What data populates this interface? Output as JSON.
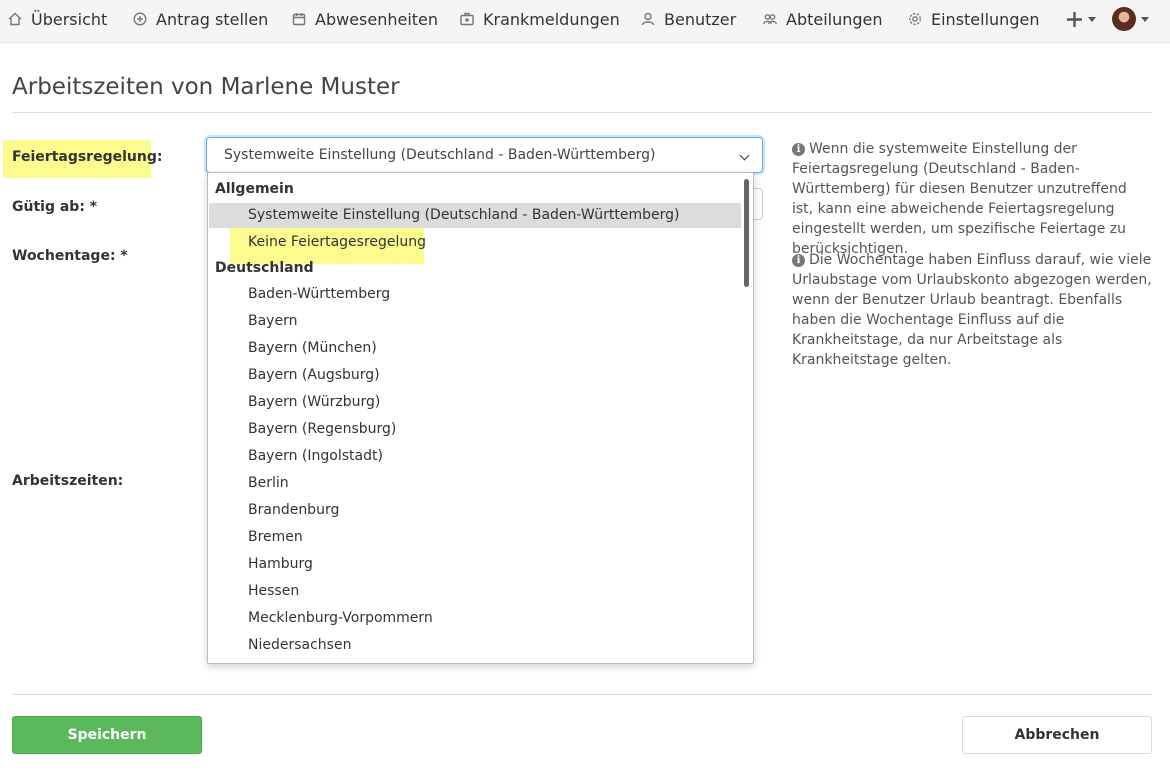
{
  "nav": {
    "overview": "Übersicht",
    "apply": "Antrag stellen",
    "absences": "Abwesenheiten",
    "sick_notes": "Krankmeldungen",
    "users": "Benutzer",
    "departments": "Abteilungen",
    "settings": "Einstellungen"
  },
  "page": {
    "title": "Arbeitszeiten von Marlene Muster"
  },
  "form": {
    "holiday_label": "Feiertagsregelung:",
    "valid_from_label": "Gütig ab: *",
    "weekdays_label": "Wochentage: *",
    "working_hours_label": "Arbeitszeiten:",
    "select_value": "Systemweite Einstellung (Deutschland - Baden-Württemberg)"
  },
  "dropdown": {
    "group_general": "Allgemein",
    "opt_system": "Systemweite Einstellung (Deutschland - Baden-Württemberg)",
    "opt_none": "Keine Feiertagesregelung",
    "group_germany": "Deutschland",
    "states": [
      "Baden-Württemberg",
      "Bayern",
      "Bayern (München)",
      "Bayern (Augsburg)",
      "Bayern (Würzburg)",
      "Bayern (Regensburg)",
      "Bayern (Ingolstadt)",
      "Berlin",
      "Brandenburg",
      "Bremen",
      "Hamburg",
      "Hessen",
      "Mecklenburg-Vorpommern",
      "Niedersachsen"
    ]
  },
  "hints": {
    "holiday": "Wenn die systemweite Einstellung der Feiertagsregelung (Deutschland - Baden-Württemberg) für diesen Benutzer unzutreffend ist, kann eine abweichende Feiertagsregelung eingestellt werden, um spezifische Feiertage zu berücksichtigen.",
    "weekdays": "Die Wochentage haben Einfluss darauf, wie viele Urlaubstage vom Urlaubskonto abgezogen werden, wenn der Benutzer Urlaub beantragt. Ebenfalls haben die Wochentage Einfluss auf die Krankheitstage, da nur Arbeitstage als Krankheitstage gelten."
  },
  "buttons": {
    "save": "Speichern",
    "cancel": "Abbrechen"
  },
  "colors": {
    "primary_green": "#5cb85c",
    "highlight_yellow": "#fbfb8e",
    "focus_blue": "#66afe9"
  },
  "icons": [
    "home-icon",
    "plus-circle-icon",
    "calendar-icon",
    "medkit-icon",
    "user-icon",
    "users-icon",
    "gear-icon",
    "plus-icon",
    "avatar"
  ]
}
